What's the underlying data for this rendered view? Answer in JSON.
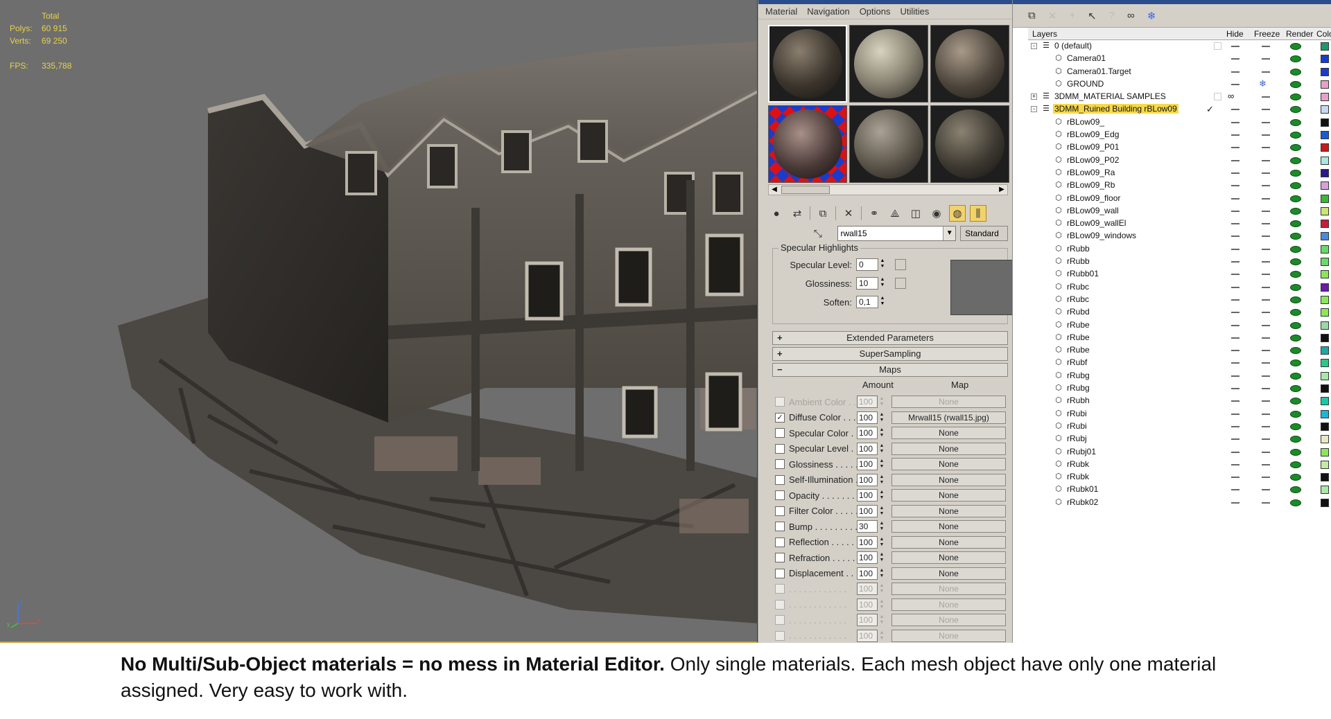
{
  "viewport": {
    "stats_header": "Total",
    "polys_label": "Polys:",
    "polys_value": "60 915",
    "verts_label": "Verts:",
    "verts_value": "69 250",
    "fps_label": "FPS:",
    "fps_value": "335,788"
  },
  "material_editor": {
    "menu": [
      "Material",
      "Navigation",
      "Options",
      "Utilities"
    ],
    "material_name": "rwall15",
    "material_type": "Standard",
    "specular": {
      "group_title": "Specular Highlights",
      "specular_level_label": "Specular Level:",
      "specular_level_value": "0",
      "glossiness_label": "Glossiness:",
      "glossiness_value": "10",
      "soften_label": "Soften:",
      "soften_value": "0,1"
    },
    "rollouts": {
      "extended": "Extended Parameters",
      "supersampling": "SuperSampling",
      "maps": "Maps"
    },
    "maps_header": {
      "amount": "Amount",
      "map": "Map"
    },
    "maps": [
      {
        "name": "Ambient Color . . .",
        "amount": "100",
        "map": "None",
        "checked": false,
        "disabled": true
      },
      {
        "name": "Diffuse Color . . .",
        "amount": "100",
        "map": "Mrwall15 (rwall15.jpg)",
        "checked": true,
        "disabled": false
      },
      {
        "name": "Specular Color . .",
        "amount": "100",
        "map": "None",
        "checked": false,
        "disabled": false
      },
      {
        "name": "Specular Level . .",
        "amount": "100",
        "map": "None",
        "checked": false,
        "disabled": false
      },
      {
        "name": "Glossiness . . . . .",
        "amount": "100",
        "map": "None",
        "checked": false,
        "disabled": false
      },
      {
        "name": "Self-Illumination . .",
        "amount": "100",
        "map": "None",
        "checked": false,
        "disabled": false
      },
      {
        "name": "Opacity . . . . . . .",
        "amount": "100",
        "map": "None",
        "checked": false,
        "disabled": false
      },
      {
        "name": "Filter Color . . . . .",
        "amount": "100",
        "map": "None",
        "checked": false,
        "disabled": false
      },
      {
        "name": "Bump . . . . . . . . .",
        "amount": "30",
        "map": "None",
        "checked": false,
        "disabled": false
      },
      {
        "name": "Reflection . . . . .",
        "amount": "100",
        "map": "None",
        "checked": false,
        "disabled": false
      },
      {
        "name": "Refraction . . . . .",
        "amount": "100",
        "map": "None",
        "checked": false,
        "disabled": false
      },
      {
        "name": "Displacement . . .",
        "amount": "100",
        "map": "None",
        "checked": false,
        "disabled": false
      },
      {
        "name": ". . . . . . . . . . . .",
        "amount": "100",
        "map": "None",
        "checked": false,
        "disabled": true
      },
      {
        "name": ". . . . . . . . . . . .",
        "amount": "100",
        "map": "None",
        "checked": false,
        "disabled": true
      },
      {
        "name": ". . . . . . . . . . . .",
        "amount": "100",
        "map": "None",
        "checked": false,
        "disabled": true
      },
      {
        "name": ". . . . . . . . . . . .",
        "amount": "100",
        "map": "None",
        "checked": false,
        "disabled": true
      }
    ]
  },
  "layer_manager": {
    "headers": {
      "layers": "Layers",
      "hide": "Hide",
      "freeze": "Freeze",
      "render": "Render",
      "color": "Color"
    },
    "rows": [
      {
        "name": "0 (default)",
        "kind": "layer",
        "expander": "-",
        "color": "#1a9a6a"
      },
      {
        "name": "Camera01",
        "kind": "object",
        "color": "#1a3ccc"
      },
      {
        "name": "Camera01.Target",
        "kind": "object",
        "color": "#1a3ccc"
      },
      {
        "name": "GROUND",
        "kind": "object",
        "color": "#e8a0c8",
        "frozen": true
      },
      {
        "name": "3DMM_MATERIAL SAMPLES",
        "kind": "layer",
        "expander": "+",
        "color": "#e8a0c8",
        "hidden": true
      },
      {
        "name": "3DMM_Ruined Building rBLow09",
        "kind": "layer",
        "expander": "-",
        "color": "#c8d8f0",
        "current": true
      },
      {
        "name": "rBLow09_",
        "kind": "object",
        "color": "#111111"
      },
      {
        "name": "rBLow09_Edg",
        "kind": "object",
        "color": "#1a5ad8"
      },
      {
        "name": "rBLow09_P01",
        "kind": "object",
        "color": "#c81a1a"
      },
      {
        "name": "rBLow09_P02",
        "kind": "object",
        "color": "#a8e8e0"
      },
      {
        "name": "rBLow09_Ra",
        "kind": "object",
        "color": "#2a1a8a"
      },
      {
        "name": "rBLow09_Rb",
        "kind": "object",
        "color": "#d8a0d8"
      },
      {
        "name": "rBLow09_floor",
        "kind": "object",
        "color": "#3ab83a"
      },
      {
        "name": "rBLow09_wall",
        "kind": "object",
        "color": "#c8e870"
      },
      {
        "name": "rBLow09_wallEl",
        "kind": "object",
        "color": "#c81a3a"
      },
      {
        "name": "rBLow09_windows",
        "kind": "object",
        "color": "#4a8ad8"
      },
      {
        "name": "rRubb",
        "kind": "object",
        "color": "#6ad86a"
      },
      {
        "name": "rRubb",
        "kind": "object",
        "color": "#6ad86a"
      },
      {
        "name": "rRubb01",
        "kind": "object",
        "color": "#8ae858"
      },
      {
        "name": "rRubc",
        "kind": "object",
        "color": "#6a1aa8"
      },
      {
        "name": "rRubc",
        "kind": "object",
        "color": "#8ae858"
      },
      {
        "name": "rRubd",
        "kind": "object",
        "color": "#8ae858"
      },
      {
        "name": "rRube",
        "kind": "object",
        "color": "#9ad8a8"
      },
      {
        "name": "rRube",
        "kind": "object",
        "color": "#111111"
      },
      {
        "name": "rRube",
        "kind": "object",
        "color": "#1aa8a8"
      },
      {
        "name": "rRubf",
        "kind": "object",
        "color": "#2ac88a"
      },
      {
        "name": "rRubg",
        "kind": "object",
        "color": "#a8e8a8"
      },
      {
        "name": "rRubg",
        "kind": "object",
        "color": "#111111"
      },
      {
        "name": "rRubh",
        "kind": "object",
        "color": "#1ac8a8"
      },
      {
        "name": "rRubi",
        "kind": "object",
        "color": "#1ab8d8"
      },
      {
        "name": "rRubi",
        "kind": "object",
        "color": "#111111"
      },
      {
        "name": "rRubj",
        "kind": "object",
        "color": "#e8e8c8"
      },
      {
        "name": "rRubj01",
        "kind": "object",
        "color": "#8ae858"
      },
      {
        "name": "rRubk",
        "kind": "object",
        "color": "#c8e8a8"
      },
      {
        "name": "rRubk",
        "kind": "object",
        "color": "#111111"
      },
      {
        "name": "rRubk01",
        "kind": "object",
        "color": "#a8e8a8"
      },
      {
        "name": "rRubk02",
        "kind": "object",
        "color": "#111111"
      }
    ]
  },
  "caption": {
    "bold": "No Multi/Sub-Object materials = no mess in Material Editor.",
    "rest": " Only single materials. Each mesh object have only one material assigned. Very easy to work with."
  }
}
